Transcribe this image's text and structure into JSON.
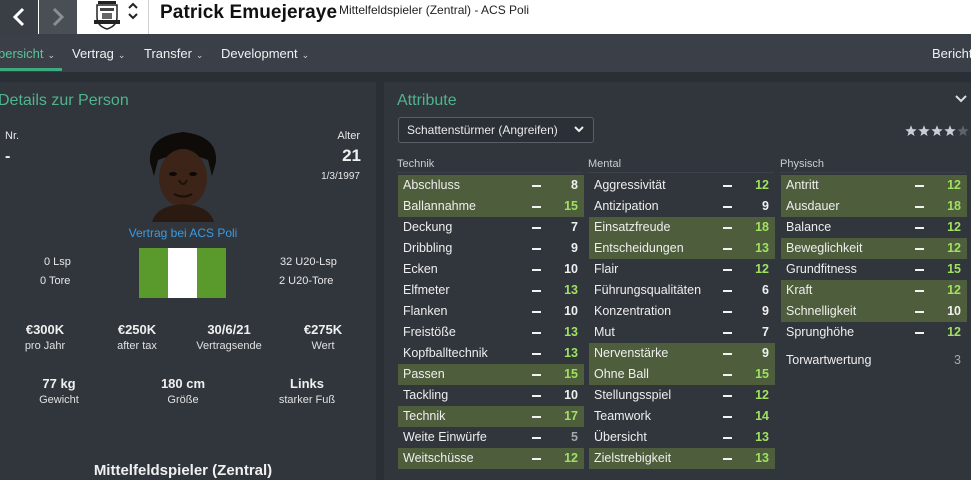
{
  "header": {
    "player_name": "Patrick Emuejeraye",
    "player_subtitle": "Mittelfeldspieler (Zentral) - ACS Poli"
  },
  "tabs": [
    {
      "label": "bersicht",
      "active": true
    },
    {
      "label": "Vertrag"
    },
    {
      "label": "Transfer"
    },
    {
      "label": "Development"
    },
    {
      "label": "Bericht"
    }
  ],
  "details": {
    "title": "Details zur Person",
    "number_label": "Nr.",
    "number_value": "-",
    "age_label": "Alter",
    "age_value": "21",
    "birthdate": "1/3/1997",
    "contract_text": "Vertrag bei ACS Poli",
    "caps": "0 Lsp",
    "goals": "0 Tore",
    "u20_caps": "32 U20-Lsp",
    "u20_goals": "2 U20-Tore",
    "flag_colors": [
      "#5a9a2c",
      "#ffffff",
      "#5a9a2c"
    ],
    "finance": [
      {
        "value": "€300K",
        "label": "pro Jahr"
      },
      {
        "value": "€250K",
        "label": "after tax"
      },
      {
        "value": "30/6/21",
        "label": "Vertragsende"
      },
      {
        "value": "€275K",
        "label": "Wert"
      }
    ],
    "physical": [
      {
        "value": "77 kg",
        "label": "Gewicht"
      },
      {
        "value": "180 cm",
        "label": "Größe"
      },
      {
        "value": "Links",
        "label": "starker Fuß"
      }
    ],
    "position": "Mittelfeldspieler (Zentral)"
  },
  "attributes": {
    "title": "Attribute",
    "role": "Schattenstürmer (Angreifen)",
    "star_rating": 4,
    "star_max": 5,
    "columns": [
      {
        "heading": "Technik",
        "rows": [
          {
            "name": "Abschluss",
            "value": "8",
            "highlight": true
          },
          {
            "name": "Ballannahme",
            "value": "15",
            "highlight": true
          },
          {
            "name": "Deckung",
            "value": "7",
            "highlight": false
          },
          {
            "name": "Dribbling",
            "value": "9",
            "highlight": false
          },
          {
            "name": "Ecken",
            "value": "10",
            "highlight": false
          },
          {
            "name": "Elfmeter",
            "value": "13",
            "highlight": false
          },
          {
            "name": "Flanken",
            "value": "10",
            "highlight": false
          },
          {
            "name": "Freistöße",
            "value": "13",
            "highlight": false
          },
          {
            "name": "Kopfballtechnik",
            "value": "13",
            "highlight": false
          },
          {
            "name": "Passen",
            "value": "15",
            "highlight": true
          },
          {
            "name": "Tackling",
            "value": "10",
            "highlight": false
          },
          {
            "name": "Technik",
            "value": "17",
            "highlight": true
          },
          {
            "name": "Weite Einwürfe",
            "value": "5",
            "highlight": false
          },
          {
            "name": "Weitschüsse",
            "value": "12",
            "highlight": true
          }
        ]
      },
      {
        "heading": "Mental",
        "rows": [
          {
            "name": "Aggressivität",
            "value": "12",
            "highlight": false
          },
          {
            "name": "Antizipation",
            "value": "9",
            "highlight": false
          },
          {
            "name": "Einsatzfreude",
            "value": "18",
            "highlight": true
          },
          {
            "name": "Entscheidungen",
            "value": "13",
            "highlight": true
          },
          {
            "name": "Flair",
            "value": "12",
            "highlight": false
          },
          {
            "name": "Führungsqualitäten",
            "value": "6",
            "highlight": false
          },
          {
            "name": "Konzentration",
            "value": "9",
            "highlight": false
          },
          {
            "name": "Mut",
            "value": "7",
            "highlight": false
          },
          {
            "name": "Nervenstärke",
            "value": "9",
            "highlight": true
          },
          {
            "name": "Ohne Ball",
            "value": "15",
            "highlight": true
          },
          {
            "name": "Stellungsspiel",
            "value": "12",
            "highlight": false
          },
          {
            "name": "Teamwork",
            "value": "14",
            "highlight": false
          },
          {
            "name": "Übersicht",
            "value": "13",
            "highlight": false
          },
          {
            "name": "Zielstrebigkeit",
            "value": "13",
            "highlight": true
          }
        ]
      },
      {
        "heading": "Physisch",
        "rows": [
          {
            "name": "Antritt",
            "value": "12",
            "highlight": true
          },
          {
            "name": "Ausdauer",
            "value": "18",
            "highlight": true
          },
          {
            "name": "Balance",
            "value": "12",
            "highlight": false
          },
          {
            "name": "Beweglichkeit",
            "value": "12",
            "highlight": true
          },
          {
            "name": "Grundfitness",
            "value": "15",
            "highlight": false
          },
          {
            "name": "Kraft",
            "value": "12",
            "highlight": true
          },
          {
            "name": "Schnelligkeit",
            "value": "10",
            "highlight": true
          },
          {
            "name": "Sprunghöhe",
            "value": "12",
            "highlight": false
          }
        ]
      }
    ],
    "goalkeeper_rating": {
      "name": "Torwartwertung",
      "value": "3"
    }
  }
}
